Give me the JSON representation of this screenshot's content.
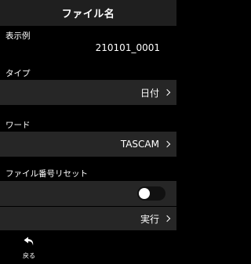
{
  "header": {
    "title": "ファイル名"
  },
  "preview": {
    "label": "表示例",
    "value": "210101_0001"
  },
  "type_setting": {
    "label": "タイプ",
    "value": "日付"
  },
  "word_setting": {
    "label": "ワード",
    "value": "TASCAM"
  },
  "file_number_reset": {
    "label": "ファイル番号リセット",
    "toggle_state": "off",
    "action_label": "実行"
  },
  "footer": {
    "back_label": "戻る",
    "back_icon": "return-arrow-icon"
  },
  "colors": {
    "background": "#000000",
    "title_bar": "#1f1f1f",
    "row": "#262626",
    "text": "#ffffff"
  }
}
